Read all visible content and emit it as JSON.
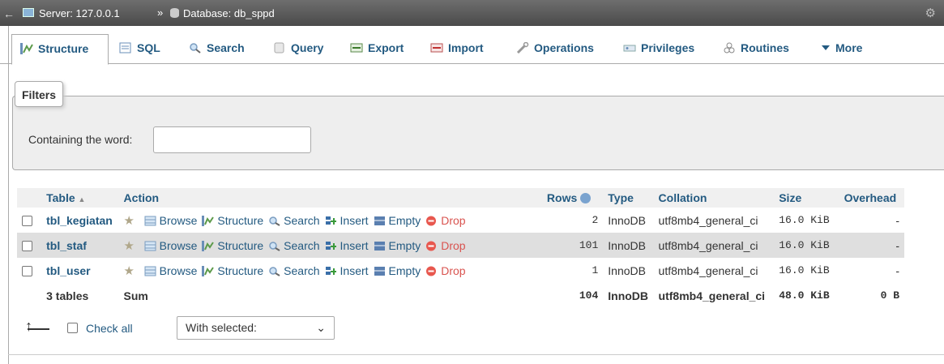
{
  "breadcrumb": {
    "server": "Server: 127.0.0.1",
    "separator": "»",
    "database": "Database: db_sppd"
  },
  "tabs": [
    {
      "label": "Structure",
      "icon": "structure-icon",
      "active": true
    },
    {
      "label": "SQL",
      "icon": "sql-icon"
    },
    {
      "label": "Search",
      "icon": "search-icon"
    },
    {
      "label": "Query",
      "icon": "query-icon"
    },
    {
      "label": "Export",
      "icon": "export-icon"
    },
    {
      "label": "Import",
      "icon": "import-icon"
    },
    {
      "label": "Operations",
      "icon": "wrench-icon"
    },
    {
      "label": "Privileges",
      "icon": "privileges-icon"
    },
    {
      "label": "Routines",
      "icon": "routines-icon"
    },
    {
      "label": "More",
      "icon": "triangle-down-icon"
    }
  ],
  "filters": {
    "legend": "Filters",
    "label": "Containing the word:",
    "value": ""
  },
  "table": {
    "headers": {
      "table": "Table",
      "sort_indicator": "▲",
      "action": "Action",
      "rows": "Rows",
      "type": "Type",
      "collation": "Collation",
      "size": "Size",
      "overhead": "Overhead"
    },
    "actions": [
      "Browse",
      "Structure",
      "Search",
      "Insert",
      "Empty",
      "Drop"
    ],
    "rows": [
      {
        "name": "tbl_kegiatan",
        "rows": "2",
        "type": "InnoDB",
        "collation": "utf8mb4_general_ci",
        "size": "16.0 KiB",
        "overhead": "-"
      },
      {
        "name": "tbl_staf",
        "rows": "101",
        "type": "InnoDB",
        "collation": "utf8mb4_general_ci",
        "size": "16.0 KiB",
        "overhead": "-"
      },
      {
        "name": "tbl_user",
        "rows": "1",
        "type": "InnoDB",
        "collation": "utf8mb4_general_ci",
        "size": "16.0 KiB",
        "overhead": "-"
      }
    ],
    "summary": {
      "name": "3 tables",
      "action": "Sum",
      "rows": "104",
      "type": "InnoDB",
      "collation": "utf8mb4_general_ci",
      "size": "48.0 KiB",
      "overhead": "0 B"
    }
  },
  "bottom": {
    "check_all": "Check all",
    "with_selected": "With selected:"
  },
  "colors": {
    "link": "#235a81",
    "drop": "#d9534f",
    "alt_row": "#dfdfdf"
  }
}
